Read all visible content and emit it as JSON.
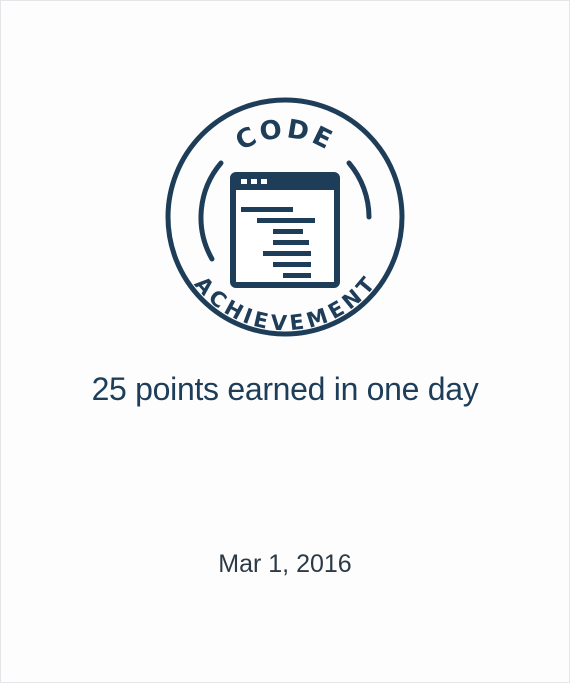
{
  "badge": {
    "top_text": "CODE",
    "bottom_text": "ACHIEVEMENT",
    "color": "#1e3d58"
  },
  "achievement": {
    "title": "25 points earned in one day",
    "date": "Mar 1, 2016"
  },
  "colors": {
    "primary": "#1e3d58",
    "date_text": "#2c3a47",
    "background": "#ffffff",
    "border": "#e3e5e8"
  }
}
